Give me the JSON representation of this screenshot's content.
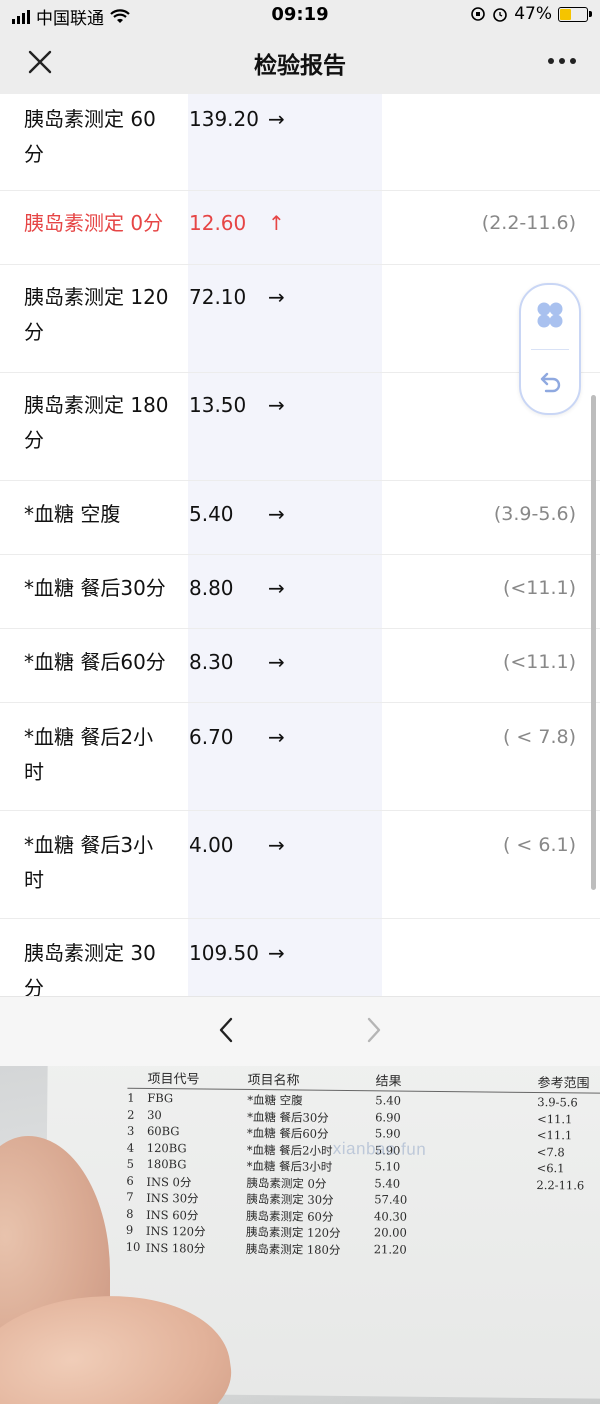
{
  "status_bar": {
    "carrier": "中国联通",
    "time": "09:19",
    "battery_percent": "47%",
    "battery_level": 0.47
  },
  "header": {
    "title": "检验报告"
  },
  "rows": [
    {
      "name": "胰岛素测定 60分",
      "value": "139.20",
      "arrow": "→",
      "range": "",
      "abnormal": false
    },
    {
      "name": "胰岛素测定 0分",
      "value": "12.60",
      "arrow": "↑",
      "range": "(2.2-11.6)",
      "abnormal": true
    },
    {
      "name": "胰岛素测定 120分",
      "value": "72.10",
      "arrow": "→",
      "range": "",
      "abnormal": false
    },
    {
      "name": "胰岛素测定 180分",
      "value": "13.50",
      "arrow": "→",
      "range": "",
      "abnormal": false
    },
    {
      "name": "*血糖 空腹",
      "value": "5.40",
      "arrow": "→",
      "range": "(3.9-5.6)",
      "abnormal": false
    },
    {
      "name": "*血糖 餐后30分",
      "value": "8.80",
      "arrow": "→",
      "range": "(<11.1)",
      "abnormal": false
    },
    {
      "name": "*血糖 餐后60分",
      "value": "8.30",
      "arrow": "→",
      "range": "(<11.1)",
      "abnormal": false
    },
    {
      "name": "*血糖 餐后2小时",
      "value": "6.70",
      "arrow": "→",
      "range": "( < 7.8)",
      "abnormal": false
    },
    {
      "name": "*血糖 餐后3小时",
      "value": "4.00",
      "arrow": "→",
      "range": "( < 6.1)",
      "abnormal": false
    },
    {
      "name": "胰岛素测定 30分",
      "value": "109.50",
      "arrow": "→",
      "range": "",
      "abnormal": false
    }
  ],
  "photo": {
    "headers": {
      "code": "项目代号",
      "name": "项目名称",
      "result": "结果",
      "range": "参考范围"
    },
    "rows": [
      {
        "idx": "1",
        "code": "FBG",
        "name": "*血糖 空腹",
        "result": "5.40",
        "range": "3.9-5.6"
      },
      {
        "idx": "2",
        "code": "30",
        "name": "*血糖 餐后30分",
        "result": "6.90",
        "range": "<11.1"
      },
      {
        "idx": "3",
        "code": "60BG",
        "name": "*血糖 餐后60分",
        "result": "5.90",
        "range": "<11.1"
      },
      {
        "idx": "4",
        "code": "120BG",
        "name": "*血糖 餐后2小时",
        "result": "5.90",
        "range": "<7.8"
      },
      {
        "idx": "5",
        "code": "180BG",
        "name": "*血糖 餐后3小时",
        "result": "5.10",
        "range": "<6.1"
      },
      {
        "idx": "6",
        "code": "INS 0分",
        "name": "胰岛素测定 0分",
        "result": "5.40",
        "range": "2.2-11.6"
      },
      {
        "idx": "7",
        "code": "INS 30分",
        "name": "胰岛素测定 30分",
        "result": "57.40",
        "range": ""
      },
      {
        "idx": "8",
        "code": "INS 60分",
        "name": "胰岛素测定 60分",
        "result": "40.30",
        "range": ""
      },
      {
        "idx": "9",
        "code": "INS 120分",
        "name": "胰岛素测定 120分",
        "result": "20.00",
        "range": ""
      },
      {
        "idx": "10",
        "code": "INS 180分",
        "name": "胰岛素测定 180分",
        "result": "21.20",
        "range": ""
      }
    ],
    "watermark": "xianbao.fun"
  },
  "icons": {
    "close": "close-icon",
    "more": "more-dots-icon",
    "apps": "apps-clover-icon",
    "back": "undo-icon",
    "prev": "chevron-left-icon",
    "next": "chevron-right-icon"
  },
  "colors": {
    "abnormal": "#e64545",
    "range_gray": "#888888",
    "highlight_col": "#f3f4fb",
    "header_bg": "#ededed"
  }
}
